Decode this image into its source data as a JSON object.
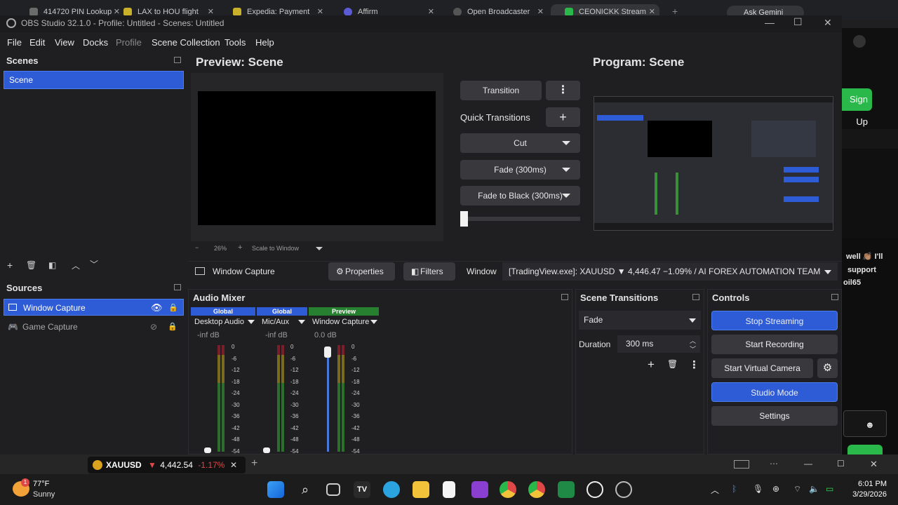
{
  "browser": {
    "tabs": [
      {
        "label": "414720 PIN Lookup"
      },
      {
        "label": "LAX to HOU flight"
      },
      {
        "label": "Expedia: Payment"
      },
      {
        "label": "Affirm"
      },
      {
        "label": "Open Broadcaster"
      },
      {
        "label": "CEONICKK Stream"
      }
    ],
    "gemini_label": "Ask Gemini",
    "page_signup": "Sign Up",
    "chat_lines": [
      "well 👏🏽 I'll",
      "support",
      "oil65"
    ]
  },
  "obs": {
    "window_title": "OBS Studio 32.1.0 - Profile: Untitled - Scenes: Untitled",
    "menu": [
      "File",
      "Edit",
      "View",
      "Docks",
      "Profile",
      "Scene Collection",
      "Tools",
      "Help"
    ],
    "scenes": {
      "title": "Scenes",
      "items": [
        "Scene"
      ]
    },
    "sources": {
      "title": "Sources",
      "items": [
        "Window Capture",
        "Game Capture"
      ]
    },
    "preview": {
      "title": "Preview: Scene",
      "zoom": "26%",
      "scale_label": "Scale to Window"
    },
    "program": {
      "title": "Program: Scene"
    },
    "transition": {
      "transition_label": "Transition",
      "quick_label": "Quick Transitions",
      "buttons": [
        "Cut",
        "Fade (300ms)",
        "Fade to Black (300ms)"
      ]
    },
    "source_toolbar": {
      "source_name": "Window Capture",
      "properties": "Properties",
      "filters": "Filters",
      "window_label": "Window",
      "window_value": "[TradingView.exe]: XAUUSD ▼ 4,446.47 −1.09% / AI FOREX AUTOMATION TEAM"
    },
    "audio_mixer": {
      "title": "Audio Mixer",
      "channels": [
        {
          "tag": "Global",
          "name": "Desktop Audio",
          "db": "-inf dB"
        },
        {
          "tag": "Global",
          "name": "Mic/Aux",
          "db": "-inf dB"
        },
        {
          "tag": "Preview",
          "name": "Window Capture",
          "db": "0.0 dB"
        }
      ],
      "scale": [
        "0",
        "-6",
        "-12",
        "-18",
        "-24",
        "-30",
        "-36",
        "-42",
        "-48",
        "-54"
      ]
    },
    "scene_transitions": {
      "title": "Scene Transitions",
      "selected": "Fade",
      "duration_label": "Duration",
      "duration_value": "300 ms"
    },
    "controls": {
      "title": "Controls",
      "stop_streaming": "Stop Streaming",
      "start_recording": "Start Recording",
      "start_virtual_camera": "Start Virtual Camera",
      "studio_mode": "Studio Mode",
      "settings": "Settings"
    },
    "colors": {
      "accent": "#2e5bd6",
      "panel": "#1f1f22",
      "button": "#38383d"
    }
  },
  "ticker": {
    "symbol": "XAUUSD",
    "price": "4,442.54",
    "change": "-1.17%",
    "direction": "▼"
  },
  "taskbar": {
    "weather_temp": "77°F",
    "weather_desc": "Sunny",
    "weather_badge": "1",
    "time": "6:01 PM",
    "date": "3/29/2026",
    "icons": [
      "windows-start-icon",
      "search-icon",
      "task-view-icon",
      "tradingview-icon",
      "telegram-icon",
      "file-explorer-icon",
      "notepad-icon",
      "twitch-icon",
      "chrome-icon",
      "chrome-profile-icon",
      "excel-icon",
      "chatgpt-icon",
      "obs-icon"
    ]
  }
}
